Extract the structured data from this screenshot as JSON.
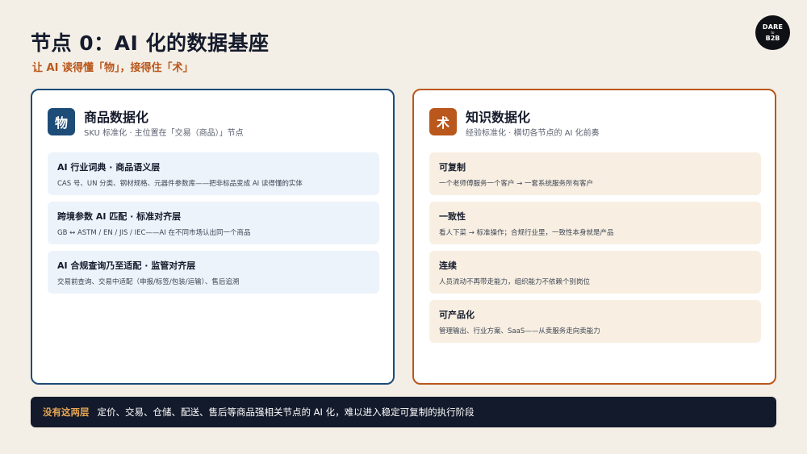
{
  "slide": {
    "title": "节点 0：AI 化的数据基座",
    "subtitle": "让 AI 读得懂「物」，接得住「术」"
  },
  "logo": {
    "line1": "DARE",
    "line2": "to",
    "line3": "B2B"
  },
  "left_card": {
    "badge": "物",
    "title": "商品数据化",
    "subtitle": "SKU 标准化 · 主位置在「交易（商品）」节点",
    "items": [
      {
        "title": "AI 行业词典 · 商品语义层",
        "desc": "CAS 号、UN 分类、钢材规格、元器件参数库——把非标品变成 AI 读得懂的实体"
      },
      {
        "title": "跨境参数 AI 匹配 · 标准对齐层",
        "desc": "GB ↔ ASTM / EN / JIS / IEC——AI 在不同市场认出同一个商品"
      },
      {
        "title": "AI 合规查询乃至适配 · 监管对齐层",
        "desc": "交易前查询、交易中适配（申报/标签/包装/运输）、售后追溯"
      }
    ]
  },
  "right_card": {
    "badge": "术",
    "title": "知识数据化",
    "subtitle": "经验标准化 · 横切各节点的 AI 化前奏",
    "items": [
      {
        "title": "可复制",
        "desc": "一个老师傅服务一个客户 → 一套系统服务所有客户"
      },
      {
        "title": "一致性",
        "desc": "看人下菜 → 标准操作；合规行业里，一致性本身就是产品"
      },
      {
        "title": "连续",
        "desc": "人员流动不再带走能力，组织能力不依赖个别岗位"
      },
      {
        "title": "可产品化",
        "desc": "管理输出、行业方案、SaaS——从卖服务走向卖能力"
      }
    ]
  },
  "bottom_bar": {
    "label": "没有这两层",
    "text": "定价、交易、仓储、配送、售后等商品强相关节点的 AI 化，难以进入稳定可复制的执行阶段"
  },
  "colors": {
    "background": "#f4efe6",
    "navy": "#1d4c78",
    "orange": "#b9571c",
    "bar": "#131a2b",
    "bar_label": "#e6a653"
  }
}
